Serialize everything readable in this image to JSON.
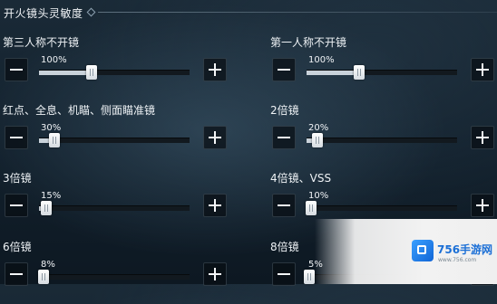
{
  "header": {
    "title": "开火镜头灵敏度"
  },
  "settings": [
    {
      "label": "第三人称不开镜",
      "value_text": "100%",
      "level": 0.35
    },
    {
      "label": "第一人称不开镜",
      "value_text": "100%",
      "level": 0.35
    },
    {
      "label": "红点、全息、机瞄、侧面瞄准镜",
      "value_text": "30%",
      "level": 0.1
    },
    {
      "label": "2倍镜",
      "value_text": "20%",
      "level": 0.07
    },
    {
      "label": "3倍镜",
      "value_text": "15%",
      "level": 0.05
    },
    {
      "label": "4倍镜、VSS",
      "value_text": "10%",
      "level": 0.03
    },
    {
      "label": "6倍镜",
      "value_text": "8%",
      "level": 0.03
    },
    {
      "label": "8倍镜",
      "value_text": "5%",
      "level": 0.02
    }
  ],
  "watermark": {
    "name": "756手游网",
    "url": "www.756.com"
  },
  "colors": {
    "fill": "#c9d2da",
    "track": "#12191f",
    "accent": "#1b6fd6"
  },
  "icons": {
    "minus": "minus-icon",
    "plus": "plus-icon",
    "header": "diamond-icon"
  }
}
